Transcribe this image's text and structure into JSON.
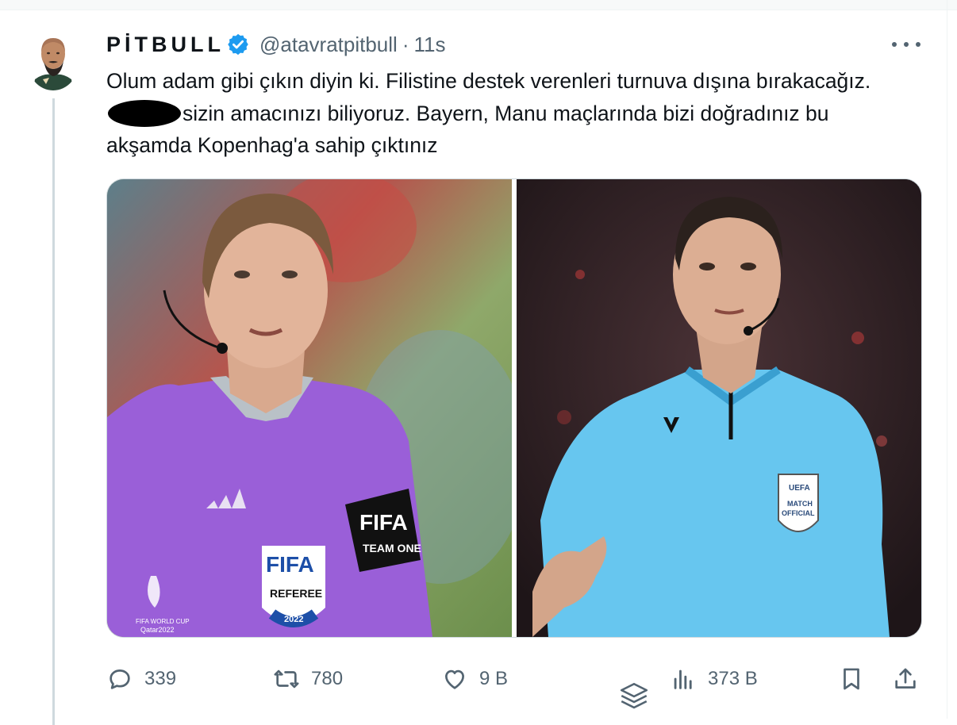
{
  "tweet": {
    "author_name": "PİTBULL",
    "handle": "@atavratpitbull",
    "separator": "·",
    "timestamp": "11s",
    "text_part1": "Olum adam gibi çıkın diyin ki. Filistine destek verenleri turnuva dışına bırakacağız.",
    "text_part2": "sizin amacınızı biliyoruz. Bayern, Manu maçlarında bizi doğradınız bu akşamda Kopenhag'a sahip çıktınız"
  },
  "media": {
    "left_photo": {
      "badge_brand": "FIFA",
      "badge_role": "REFEREE",
      "badge_year": "2022",
      "armband_line1": "FIFA",
      "armband_line2": "TEAM ONE",
      "cup_line1": "FIFA WORLD CUP",
      "cup_line2": "Qatar2022"
    },
    "right_photo": {
      "badge_line1": "UEFA",
      "badge_line2": "MATCH",
      "badge_line3": "OFFICIAL"
    }
  },
  "actions": {
    "replies": "339",
    "reposts": "780",
    "likes": "9 B",
    "views": "373 B"
  },
  "icons": [
    "verified-badge-icon",
    "more-icon",
    "reply-icon",
    "repost-icon",
    "like-icon",
    "views-icon",
    "bookmark-icon",
    "share-icon",
    "layers-icon"
  ],
  "colors": {
    "verified": "#1d9bf0",
    "text": "#0f1419",
    "secondary": "#536471"
  }
}
